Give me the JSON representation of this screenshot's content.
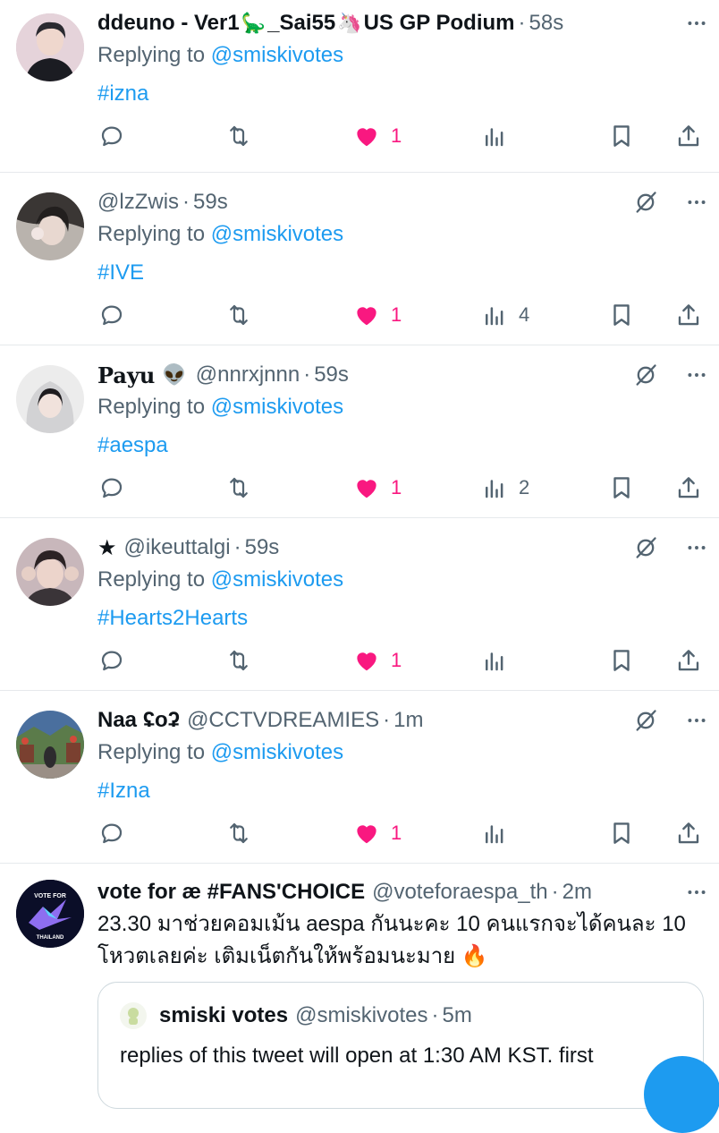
{
  "colors": {
    "link": "#1d9bf0",
    "like": "#f91880",
    "muted": "#536471",
    "text": "#0f1419"
  },
  "tweets": [
    {
      "display_name": "ddeuno - Ver1",
      "name_suffix": "_Sai55",
      "name_tail": "US GP Podium",
      "emoji1": "🦕",
      "emoji2": "🦄",
      "handle": "",
      "time": "58s",
      "replying_label": "Replying to",
      "replying_to": "@smiskivotes",
      "hashtag": "#izna",
      "likes": "1",
      "views": "",
      "icons": [
        "reply-icon",
        "retweet-icon",
        "heart-icon",
        "views-icon",
        "bookmark-icon",
        "share-icon",
        "more-icon"
      ]
    },
    {
      "display_name": "",
      "handle": "@lzZwis",
      "time": "59s",
      "replying_label": "Replying to",
      "replying_to": "@smiskivotes",
      "hashtag": "#IVE",
      "likes": "1",
      "views": "4"
    },
    {
      "display_name": "Payu",
      "emoji1": "👽",
      "handle": "@nnrxjnnn",
      "time": "59s",
      "replying_label": "Replying to",
      "replying_to": "@smiskivotes",
      "hashtag": "#aespa",
      "likes": "1",
      "views": "2"
    },
    {
      "display_name": "★",
      "handle": "@ikeuttalgi",
      "time": "59s",
      "replying_label": "Replying to",
      "replying_to": "@smiskivotes",
      "hashtag": "#Hearts2Hearts",
      "likes": "1",
      "views": ""
    },
    {
      "display_name": "Naa ʢoʡ",
      "handle": "@CCTVDREAMIES",
      "time": "1m",
      "replying_label": "Replying to",
      "replying_to": "@smiskivotes",
      "hashtag": "#Izna",
      "likes": "1",
      "views": ""
    },
    {
      "display_name": "vote for æ #FANS'CHOICE",
      "handle": "@voteforaespa_th",
      "time": "2m",
      "text_line1": "23.30 มาช่วยคอมเม้น aespa กันนะคะ 10 คนแรกจะได้คนละ 10",
      "text_line2": "โหวตเลยค่ะ เติมเน็ตกันให้พร้อมนะมาย",
      "text_emoji": "🔥",
      "avatar_text_top": "VOTE FOR",
      "avatar_text_bottom": "THAILAND",
      "quote": {
        "display_name": "smiski votes",
        "handle": "@smiskivotes",
        "time": "5m",
        "text": "replies of this tweet will open at 1:30 AM KST. first"
      }
    }
  ]
}
